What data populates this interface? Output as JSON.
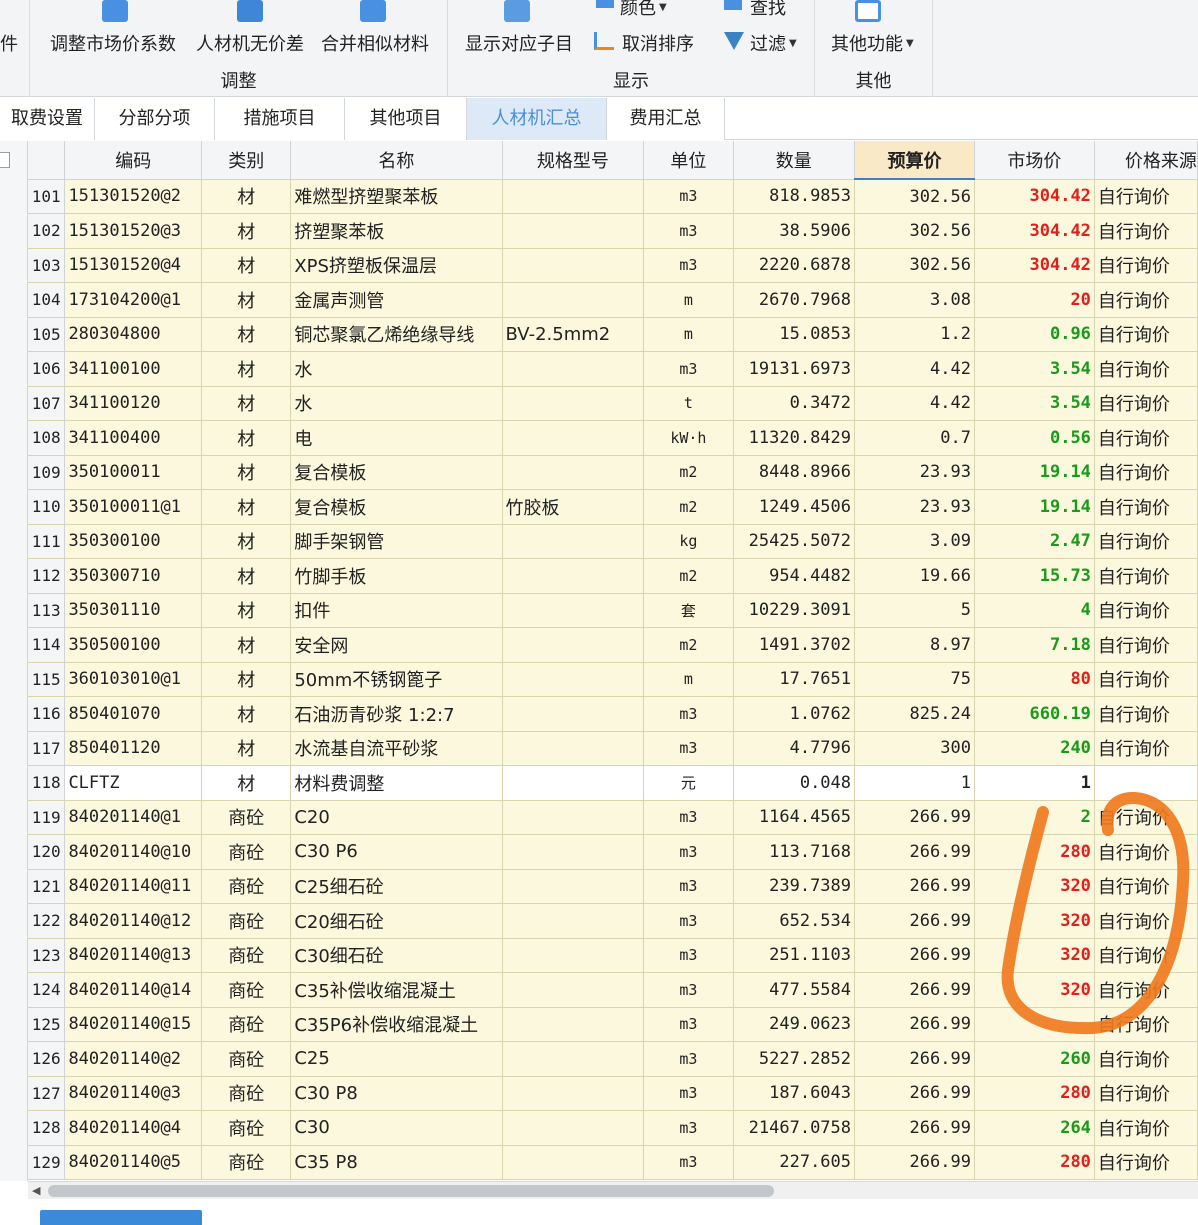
{
  "ribbon": {
    "partial_left_label": "件",
    "groups": [
      {
        "label": "调整",
        "buttons": [
          "调整市场价系数",
          "人材机无价差",
          "合并相似材料"
        ]
      },
      {
        "label": "显示",
        "buttons": [
          "显示对应子目",
          "颜色",
          "取消排序",
          "查找",
          "过滤"
        ]
      },
      {
        "label": "其他",
        "buttons": [
          "其他功能"
        ]
      }
    ]
  },
  "tabs": [
    "取费设置",
    "分部分项",
    "措施项目",
    "其他项目",
    "人材机汇总",
    "费用汇总"
  ],
  "active_tab": "人材机汇总",
  "columns": [
    "编码",
    "类别",
    "名称",
    "规格型号",
    "单位",
    "数量",
    "预算价",
    "市场价",
    "价格来源"
  ],
  "sorted_column": "预算价",
  "rows": [
    {
      "n": "101",
      "code": "151301520@2",
      "cat": "材",
      "name": "难燃型挤塑聚苯板",
      "spec": "",
      "unit": "m3",
      "qty": "818.9853",
      "budget": "302.56",
      "market": "304.42",
      "mc": "red",
      "src": "自行询价"
    },
    {
      "n": "102",
      "code": "151301520@3",
      "cat": "材",
      "name": "挤塑聚苯板",
      "spec": "",
      "unit": "m3",
      "qty": "38.5906",
      "budget": "302.56",
      "market": "304.42",
      "mc": "red",
      "src": "自行询价"
    },
    {
      "n": "103",
      "code": "151301520@4",
      "cat": "材",
      "name": "XPS挤塑板保温层",
      "spec": "",
      "unit": "m3",
      "qty": "2220.6878",
      "budget": "302.56",
      "market": "304.42",
      "mc": "red",
      "src": "自行询价"
    },
    {
      "n": "104",
      "code": "173104200@1",
      "cat": "材",
      "name": "金属声测管",
      "spec": "",
      "unit": "m",
      "qty": "2670.7968",
      "budget": "3.08",
      "market": "20",
      "mc": "red",
      "src": "自行询价"
    },
    {
      "n": "105",
      "code": "280304800",
      "cat": "材",
      "name": "铜芯聚氯乙烯绝缘导线",
      "spec": "BV-2.5mm2",
      "unit": "m",
      "qty": "15.0853",
      "budget": "1.2",
      "market": "0.96",
      "mc": "green",
      "src": "自行询价"
    },
    {
      "n": "106",
      "code": "341100100",
      "cat": "材",
      "name": "水",
      "spec": "",
      "unit": "m3",
      "qty": "19131.6973",
      "budget": "4.42",
      "market": "3.54",
      "mc": "green",
      "src": "自行询价"
    },
    {
      "n": "107",
      "code": "341100120",
      "cat": "材",
      "name": "水",
      "spec": "",
      "unit": "t",
      "qty": "0.3472",
      "budget": "4.42",
      "market": "3.54",
      "mc": "green",
      "src": "自行询价"
    },
    {
      "n": "108",
      "code": "341100400",
      "cat": "材",
      "name": "电",
      "spec": "",
      "unit": "kW·h",
      "qty": "11320.8429",
      "budget": "0.7",
      "market": "0.56",
      "mc": "green",
      "src": "自行询价"
    },
    {
      "n": "109",
      "code": "350100011",
      "cat": "材",
      "name": "复合模板",
      "spec": "",
      "unit": "m2",
      "qty": "8448.8966",
      "budget": "23.93",
      "market": "19.14",
      "mc": "green",
      "src": "自行询价"
    },
    {
      "n": "110",
      "code": "350100011@1",
      "cat": "材",
      "name": "复合模板",
      "spec": "竹胶板",
      "unit": "m2",
      "qty": "1249.4506",
      "budget": "23.93",
      "market": "19.14",
      "mc": "green",
      "src": "自行询价"
    },
    {
      "n": "111",
      "code": "350300100",
      "cat": "材",
      "name": "脚手架钢管",
      "spec": "",
      "unit": "kg",
      "qty": "25425.5072",
      "budget": "3.09",
      "market": "2.47",
      "mc": "green",
      "src": "自行询价"
    },
    {
      "n": "112",
      "code": "350300710",
      "cat": "材",
      "name": "竹脚手板",
      "spec": "",
      "unit": "m2",
      "qty": "954.4482",
      "budget": "19.66",
      "market": "15.73",
      "mc": "green",
      "src": "自行询价"
    },
    {
      "n": "113",
      "code": "350301110",
      "cat": "材",
      "name": "扣件",
      "spec": "",
      "unit": "套",
      "qty": "10229.3091",
      "budget": "5",
      "market": "4",
      "mc": "green",
      "src": "自行询价"
    },
    {
      "n": "114",
      "code": "350500100",
      "cat": "材",
      "name": "安全网",
      "spec": "",
      "unit": "m2",
      "qty": "1491.3702",
      "budget": "8.97",
      "market": "7.18",
      "mc": "green",
      "src": "自行询价"
    },
    {
      "n": "115",
      "code": "360103010@1",
      "cat": "材",
      "name": "50mm不锈钢篦子",
      "spec": "",
      "unit": "m",
      "qty": "17.7651",
      "budget": "75",
      "market": "80",
      "mc": "red",
      "src": "自行询价"
    },
    {
      "n": "116",
      "code": "850401070",
      "cat": "材",
      "name": "石油沥青砂浆 1:2:7",
      "spec": "",
      "unit": "m3",
      "qty": "1.0762",
      "budget": "825.24",
      "market": "660.19",
      "mc": "green",
      "src": "自行询价"
    },
    {
      "n": "117",
      "code": "850401120",
      "cat": "材",
      "name": "水流基自流平砂浆",
      "spec": "",
      "unit": "m3",
      "qty": "4.7796",
      "budget": "300",
      "market": "240",
      "mc": "green",
      "src": "自行询价"
    },
    {
      "n": "118",
      "code": "CLFTZ",
      "cat": "材",
      "name": "材料费调整",
      "spec": "",
      "unit": "元",
      "qty": "0.048",
      "budget": "1",
      "market": "1",
      "mc": "black",
      "src": "",
      "white": true
    },
    {
      "n": "119",
      "code": "840201140@1",
      "cat": "商砼",
      "name": "C20",
      "spec": "",
      "unit": "m3",
      "qty": "1164.4565",
      "budget": "266.99",
      "market": "2",
      "mc": "green",
      "src": "自行询价"
    },
    {
      "n": "120",
      "code": "840201140@10",
      "cat": "商砼",
      "name": "C30 P6",
      "spec": "",
      "unit": "m3",
      "qty": "113.7168",
      "budget": "266.99",
      "market": "280",
      "mc": "red",
      "src": "自行询价"
    },
    {
      "n": "121",
      "code": "840201140@11",
      "cat": "商砼",
      "name": "C25细石砼",
      "spec": "",
      "unit": "m3",
      "qty": "239.7389",
      "budget": "266.99",
      "market": "320",
      "mc": "red",
      "src": "自行询价"
    },
    {
      "n": "122",
      "code": "840201140@12",
      "cat": "商砼",
      "name": "C20细石砼",
      "spec": "",
      "unit": "m3",
      "qty": "652.534",
      "budget": "266.99",
      "market": "320",
      "mc": "red",
      "src": "自行询价"
    },
    {
      "n": "123",
      "code": "840201140@13",
      "cat": "商砼",
      "name": "C30细石砼",
      "spec": "",
      "unit": "m3",
      "qty": "251.1103",
      "budget": "266.99",
      "market": "320",
      "mc": "red",
      "src": "自行询价"
    },
    {
      "n": "124",
      "code": "840201140@14",
      "cat": "商砼",
      "name": "C35补偿收缩混凝土",
      "spec": "",
      "unit": "m3",
      "qty": "477.5584",
      "budget": "266.99",
      "market": "320",
      "mc": "red",
      "src": "自行询价"
    },
    {
      "n": "125",
      "code": "840201140@15",
      "cat": "商砼",
      "name": "C35P6补偿收缩混凝土",
      "spec": "",
      "unit": "m3",
      "qty": "249.0623",
      "budget": "266.99",
      "market": "",
      "mc": "black",
      "src": "自行询价"
    },
    {
      "n": "126",
      "code": "840201140@2",
      "cat": "商砼",
      "name": "C25",
      "spec": "",
      "unit": "m3",
      "qty": "5227.2852",
      "budget": "266.99",
      "market": "260",
      "mc": "green",
      "src": "自行询价"
    },
    {
      "n": "127",
      "code": "840201140@3",
      "cat": "商砼",
      "name": "C30 P8",
      "spec": "",
      "unit": "m3",
      "qty": "187.6043",
      "budget": "266.99",
      "market": "280",
      "mc": "red",
      "src": "自行询价"
    },
    {
      "n": "128",
      "code": "840201140@4",
      "cat": "商砼",
      "name": "C30",
      "spec": "",
      "unit": "m3",
      "qty": "21467.0758",
      "budget": "266.99",
      "market": "264",
      "mc": "green",
      "src": "自行询价"
    },
    {
      "n": "129",
      "code": "840201140@5",
      "cat": "商砼",
      "name": "C35 P8",
      "spec": "",
      "unit": "m3",
      "qty": "227.605",
      "budget": "266.99",
      "market": "280",
      "mc": "red",
      "src": "自行询价"
    }
  ],
  "colors": {
    "red": "#e0201c",
    "green": "#1a9a1a",
    "black": "#222222",
    "annotation": "#f07a1e",
    "accent": "#3b82c4"
  }
}
